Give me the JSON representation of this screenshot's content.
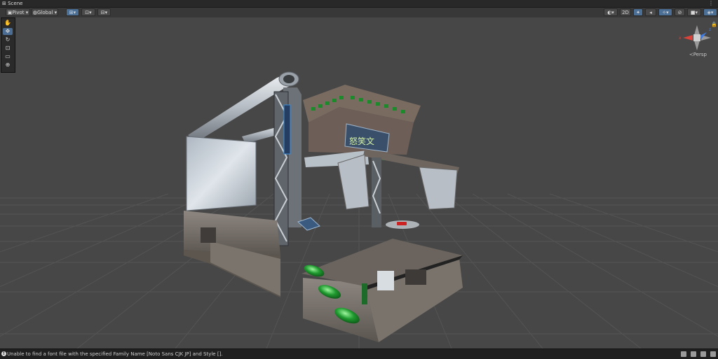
{
  "window": {
    "tab_title": "Scene",
    "kebab_icon": "more-vert-icon"
  },
  "toolbar": {
    "pivot_label": "Pivot",
    "global_label": "Global",
    "mode_2d_label": "2D"
  },
  "scene_gizmo": {
    "projection_label": "Persp",
    "axis_x": "x",
    "axis_z": "z"
  },
  "scene_text": {
    "sign_kanji": "怒笑文"
  },
  "status": {
    "message": "Unable to find a font file with the specified Family Name [Noto Sans CJK JP] and Style []."
  },
  "colors": {
    "viewport_bg": "#474747",
    "accent": "#4c6f95",
    "pipe": "#bfc5cc",
    "green_lights": "#1f9a2f"
  }
}
